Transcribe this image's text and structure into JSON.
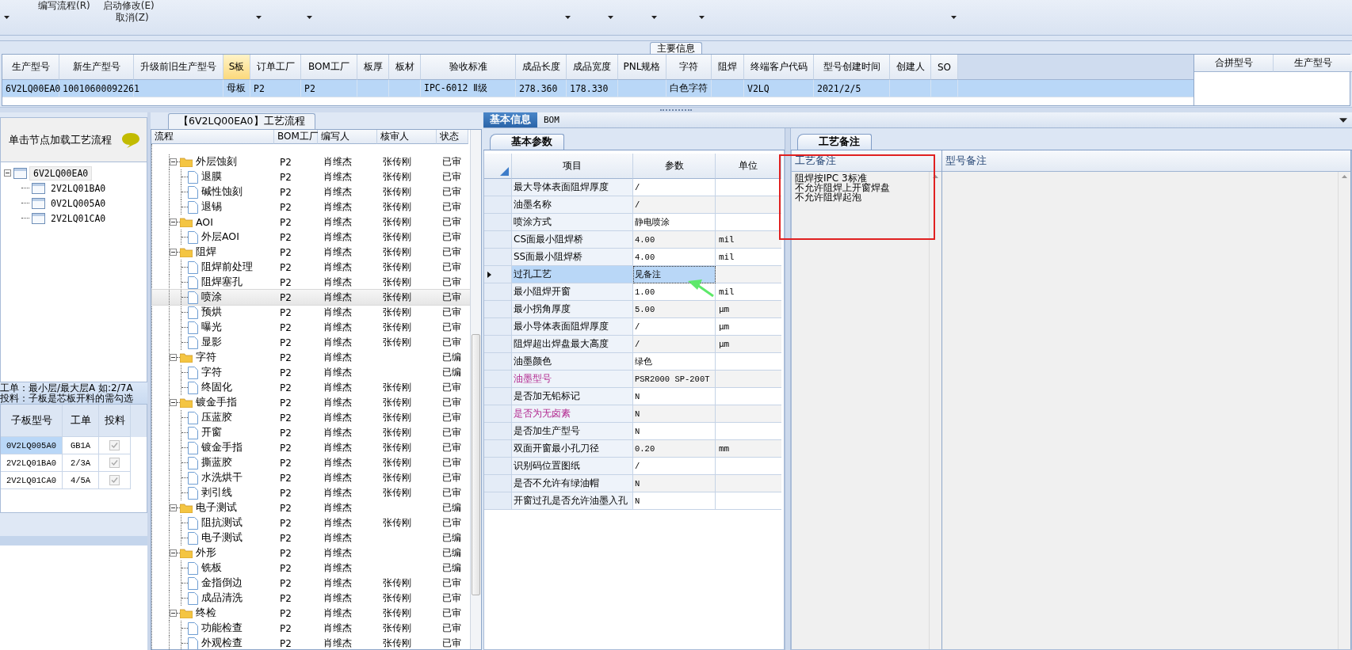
{
  "toolbar": {
    "menu_items": [
      {
        "label": "编写流程(R)"
      },
      {
        "label": "启动修改(E)"
      },
      {
        "label": "取消(Z)"
      }
    ]
  },
  "main_info": {
    "title": "主要信息",
    "row_selected": true,
    "columns": [
      {
        "label": "生产型号",
        "value": "6V2LQ00EA0",
        "highlighted": false
      },
      {
        "label": "新生产型号",
        "value": "10010600092261",
        "highlighted": false
      },
      {
        "label": "升级前旧生产型号",
        "highlighted": false
      },
      {
        "label": "S板",
        "value": "母板",
        "highlighted": true
      },
      {
        "label": "订单工厂",
        "value": "P2",
        "highlighted": false
      },
      {
        "label": "BOM工厂",
        "value": "P2",
        "highlighted": false
      },
      {
        "label": "板厚",
        "highlighted": false
      },
      {
        "label": "板材",
        "highlighted": false
      },
      {
        "label": "验收标准",
        "value": "IPC-6012 Ⅱ级",
        "highlighted": false
      },
      {
        "label": "成品长度",
        "value": "278.360",
        "highlighted": false
      },
      {
        "label": "成品宽度",
        "value": "178.330",
        "highlighted": false
      },
      {
        "label": "PNL规格",
        "highlighted": false
      },
      {
        "label": "字符",
        "value": "白色字符",
        "highlighted": false
      },
      {
        "label": "阻焊",
        "highlighted": false
      },
      {
        "label": "终端客户代码",
        "value": "V2LQ",
        "highlighted": false
      },
      {
        "label": "型号创建时间",
        "value": "2021/2/5",
        "highlighted": false
      },
      {
        "label": "创建人",
        "highlighted": false
      },
      {
        "label": "SO",
        "highlighted": false
      }
    ]
  },
  "merge_table": {
    "columns": [
      "合拼型号",
      "生产型号"
    ]
  },
  "model_tree": {
    "hint": "单击节点加载工艺流程",
    "root": {
      "label": "6V2LQ00EA0",
      "expanded": true,
      "children": [
        {
          "label": "2V2LQ01BA0"
        },
        {
          "label": "0V2LQ005A0"
        },
        {
          "label": "2V2LQ01CA0"
        }
      ]
    }
  },
  "notes": [
    "工单：最小层/最大层A 如:2/7A",
    "投料：子板是芯板开料的需勾选"
  ],
  "sub_boards": {
    "columns": [
      "子板型号",
      "工单",
      "投料"
    ],
    "rows": [
      {
        "board": "0V2LQ005A0",
        "order": "GB1A",
        "checked": true,
        "selected": true
      },
      {
        "board": "2V2LQ01BA0",
        "order": "2/3A",
        "checked": true,
        "selected": false
      },
      {
        "board": "2V2LQ01CA0",
        "order": "4/5A",
        "checked": true,
        "selected": false
      }
    ]
  },
  "process": {
    "tab": "【6V2LQ00EA0】工艺流程",
    "columns": [
      "流程",
      "BOM工厂",
      "编写人",
      "核审人",
      "状态"
    ],
    "steps": [
      {
        "name": "外层蚀刻",
        "bom": "P2",
        "writer": "肖维杰",
        "reviewer": "张传刚",
        "status": "已审",
        "expanded": true,
        "selected": false,
        "children": [
          {
            "name": "退膜",
            "bom": "P2",
            "writer": "肖维杰",
            "reviewer": "张传刚",
            "status": "已审",
            "selected": false
          },
          {
            "name": "碱性蚀刻",
            "bom": "P2",
            "writer": "肖维杰",
            "reviewer": "张传刚",
            "status": "已审",
            "selected": false
          },
          {
            "name": "退锡",
            "bom": "P2",
            "writer": "肖维杰",
            "reviewer": "张传刚",
            "status": "已审",
            "selected": false
          }
        ]
      },
      {
        "name": "AOI",
        "bom": "P2",
        "writer": "肖维杰",
        "reviewer": "张传刚",
        "status": "已审",
        "expanded": true,
        "selected": false,
        "children": [
          {
            "name": "外层AOI",
            "bom": "P2",
            "writer": "肖维杰",
            "reviewer": "张传刚",
            "status": "已审",
            "selected": false
          }
        ]
      },
      {
        "name": "阻焊",
        "bom": "P2",
        "writer": "肖维杰",
        "reviewer": "张传刚",
        "status": "已审",
        "expanded": true,
        "selected": false,
        "children": [
          {
            "name": "阻焊前处理",
            "bom": "P2",
            "writer": "肖维杰",
            "reviewer": "张传刚",
            "status": "已审",
            "selected": false
          },
          {
            "name": "阻焊塞孔",
            "bom": "P2",
            "writer": "肖维杰",
            "reviewer": "张传刚",
            "status": "已审",
            "selected": false
          },
          {
            "name": "喷涂",
            "bom": "P2",
            "writer": "肖维杰",
            "reviewer": "张传刚",
            "status": "已审",
            "selected": true
          },
          {
            "name": "预烘",
            "bom": "P2",
            "writer": "肖维杰",
            "reviewer": "张传刚",
            "status": "已审",
            "selected": false
          },
          {
            "name": "曝光",
            "bom": "P2",
            "writer": "肖维杰",
            "reviewer": "张传刚",
            "status": "已审",
            "selected": false
          },
          {
            "name": "显影",
            "bom": "P2",
            "writer": "肖维杰",
            "reviewer": "张传刚",
            "status": "已审",
            "selected": false
          }
        ]
      },
      {
        "name": "字符",
        "bom": "P2",
        "writer": "肖维杰",
        "status": "已编",
        "expanded": true,
        "selected": false,
        "children": [
          {
            "name": "字符",
            "bom": "P2",
            "writer": "肖维杰",
            "status": "已编",
            "selected": false
          },
          {
            "name": "终固化",
            "bom": "P2",
            "writer": "肖维杰",
            "reviewer": "张传刚",
            "status": "已审",
            "selected": false
          }
        ]
      },
      {
        "name": "镀金手指",
        "bom": "P2",
        "writer": "肖维杰",
        "reviewer": "张传刚",
        "status": "已审",
        "expanded": true,
        "selected": false,
        "children": [
          {
            "name": "压蓝胶",
            "bom": "P2",
            "writer": "肖维杰",
            "reviewer": "张传刚",
            "status": "已审",
            "selected": false
          },
          {
            "name": "开窗",
            "bom": "P2",
            "writer": "肖维杰",
            "reviewer": "张传刚",
            "status": "已审",
            "selected": false
          },
          {
            "name": "镀金手指",
            "bom": "P2",
            "writer": "肖维杰",
            "reviewer": "张传刚",
            "status": "已审",
            "selected": false
          },
          {
            "name": "撕蓝胶",
            "bom": "P2",
            "writer": "肖维杰",
            "reviewer": "张传刚",
            "status": "已审",
            "selected": false
          },
          {
            "name": "水洗烘干",
            "bom": "P2",
            "writer": "肖维杰",
            "reviewer": "张传刚",
            "status": "已审",
            "selected": false
          },
          {
            "name": "剥引线",
            "bom": "P2",
            "writer": "肖维杰",
            "reviewer": "张传刚",
            "status": "已审",
            "selected": false
          }
        ]
      },
      {
        "name": "电子测试",
        "bom": "P2",
        "writer": "肖维杰",
        "status": "已编",
        "expanded": true,
        "selected": false,
        "children": [
          {
            "name": "阻抗测试",
            "bom": "P2",
            "writer": "肖维杰",
            "reviewer": "张传刚",
            "status": "已审",
            "selected": false
          },
          {
            "name": "电子测试",
            "bom": "P2",
            "writer": "肖维杰",
            "status": "已编",
            "selected": false
          }
        ]
      },
      {
        "name": "外形",
        "bom": "P2",
        "writer": "肖维杰",
        "status": "已编",
        "expanded": true,
        "selected": false,
        "children": [
          {
            "name": "铣板",
            "bom": "P2",
            "writer": "肖维杰",
            "status": "已编",
            "selected": false
          },
          {
            "name": "金指倒边",
            "bom": "P2",
            "writer": "肖维杰",
            "reviewer": "张传刚",
            "status": "已审",
            "selected": false
          },
          {
            "name": "成品清洗",
            "bom": "P2",
            "writer": "肖维杰",
            "reviewer": "张传刚",
            "status": "已审",
            "selected": false
          }
        ]
      },
      {
        "name": "终检",
        "bom": "P2",
        "writer": "肖维杰",
        "reviewer": "张传刚",
        "status": "已审",
        "expanded": true,
        "selected": false,
        "children": [
          {
            "name": "功能检查",
            "bom": "P2",
            "writer": "肖维杰",
            "reviewer": "张传刚",
            "status": "已审",
            "selected": false
          },
          {
            "name": "外观检查",
            "bom": "P2",
            "writer": "肖维杰",
            "reviewer": "张传刚",
            "status": "已审",
            "selected": false
          }
        ]
      }
    ]
  },
  "tabs": [
    {
      "label": "基本信息",
      "selected": true
    },
    {
      "label": "BOM",
      "selected": false
    }
  ],
  "params": {
    "tab": "基本参数",
    "columns": [
      "项目",
      "参数",
      "单位"
    ],
    "rows": [
      {
        "item": "最大导体表面阻焊厚度",
        "value": "/",
        "selected": false,
        "emphasis": false
      },
      {
        "item": "油墨名称",
        "value": "/",
        "selected": false,
        "emphasis": false
      },
      {
        "item": "喷涂方式",
        "value": "静电喷涂",
        "selected": false,
        "emphasis": false
      },
      {
        "item": "CS面最小阻焊桥",
        "value": "4.00",
        "unit": "mil",
        "selected": false,
        "emphasis": false
      },
      {
        "item": "SS面最小阻焊桥",
        "value": "4.00",
        "unit": "mil",
        "selected": false,
        "emphasis": false
      },
      {
        "item": "过孔工艺",
        "value": "见备注",
        "selected": true,
        "emphasis": false
      },
      {
        "item": "最小阻焊开窗",
        "value": "1.00",
        "unit": "mil",
        "selected": false,
        "emphasis": false
      },
      {
        "item": "最小拐角厚度",
        "value": "5.00",
        "unit": "μm",
        "selected": false,
        "emphasis": false
      },
      {
        "item": "最小导体表面阻焊厚度",
        "value": "/",
        "unit": "μm",
        "selected": false,
        "emphasis": false
      },
      {
        "item": "阻焊超出焊盘最大高度",
        "value": "/",
        "unit": "μm",
        "selected": false,
        "emphasis": false
      },
      {
        "item": "油墨颜色",
        "value": "绿色",
        "selected": false,
        "emphasis": false
      },
      {
        "item": "油墨型号",
        "value": "PSR2000 SP-200T",
        "selected": false,
        "emphasis": true
      },
      {
        "item": "是否加无铅标记",
        "value": "N",
        "selected": false,
        "emphasis": false
      },
      {
        "item": "是否为无卤素",
        "value": "N",
        "selected": false,
        "emphasis": true
      },
      {
        "item": "是否加生产型号",
        "value": "N",
        "selected": false,
        "emphasis": false
      },
      {
        "item": "双面开窗最小孔刀径",
        "value": "0.20",
        "unit": "mm",
        "selected": false,
        "emphasis": false
      },
      {
        "item": "识别码位置图纸",
        "value": "/",
        "selected": false,
        "emphasis": false
      },
      {
        "item": "是否不允许有绿油帽",
        "value": "N",
        "selected": false,
        "emphasis": false
      },
      {
        "item": "开窗过孔是否允许油墨入孔",
        "value": "N",
        "selected": false,
        "emphasis": false
      }
    ]
  },
  "remarks": {
    "tab": "工艺备注",
    "columns": [
      "工艺备注",
      "型号备注"
    ],
    "process_lines": [
      "阻焊按IPC 3标准",
      "不允许阻焊上开窗焊盘",
      "不允许阻焊起泡"
    ]
  }
}
